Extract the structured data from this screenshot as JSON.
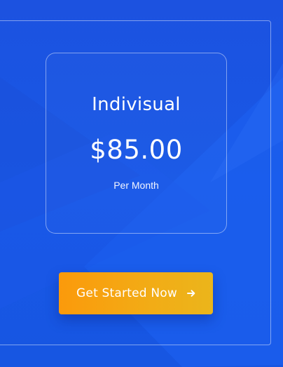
{
  "plan": {
    "name": "Indivisual",
    "price": "$85.00",
    "period": "Per Month"
  },
  "cta": {
    "label": "Get Started Now",
    "icon": "arrow-right-icon"
  },
  "colors": {
    "background": "#1a55e3",
    "button_start": "#fb9a0b",
    "button_end": "#ebb51b",
    "text": "#ffffff"
  }
}
